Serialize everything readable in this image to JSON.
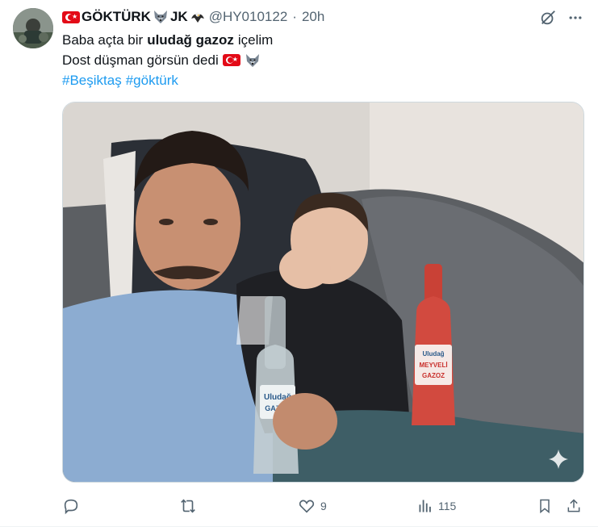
{
  "author": {
    "display_name_text": "GÖKTÜRK",
    "display_name_suffix": "JK",
    "handle": "@HY010122",
    "separator": "·",
    "time": "20h"
  },
  "tweet": {
    "line1_before": "Baba açta bir",
    "line1_bold": "uludağ gazoz",
    "line1_after": "içelim",
    "line2": "Dost düşman görsün dedi",
    "hashtag1": "#Beşiktaş",
    "hashtag2": "#göktürk"
  },
  "media": {
    "bottle_left_brand": "Uludağ",
    "bottle_left_label": "GAZOZ",
    "bottle_right_brand": "Uludağ",
    "bottle_right_label_line1": "MEYVELİ",
    "bottle_right_label_line2": "GAZOZ"
  },
  "actions": {
    "reply_count": "",
    "retweet_count": "",
    "like_count": "9",
    "views_count": "115"
  },
  "icons": [
    "wolf-emoji-icon",
    "eagle-emoji-icon",
    "turkish-flag-icon",
    "grok-icon",
    "more-icon",
    "reply-icon",
    "retweet-icon",
    "like-icon",
    "views-icon",
    "bookmark-icon",
    "share-icon",
    "sparkle-icon"
  ],
  "colors": {
    "text_primary": "#0f1419",
    "text_secondary": "#536471",
    "link": "#1d9bf0",
    "flag_red": "#e30a17"
  }
}
